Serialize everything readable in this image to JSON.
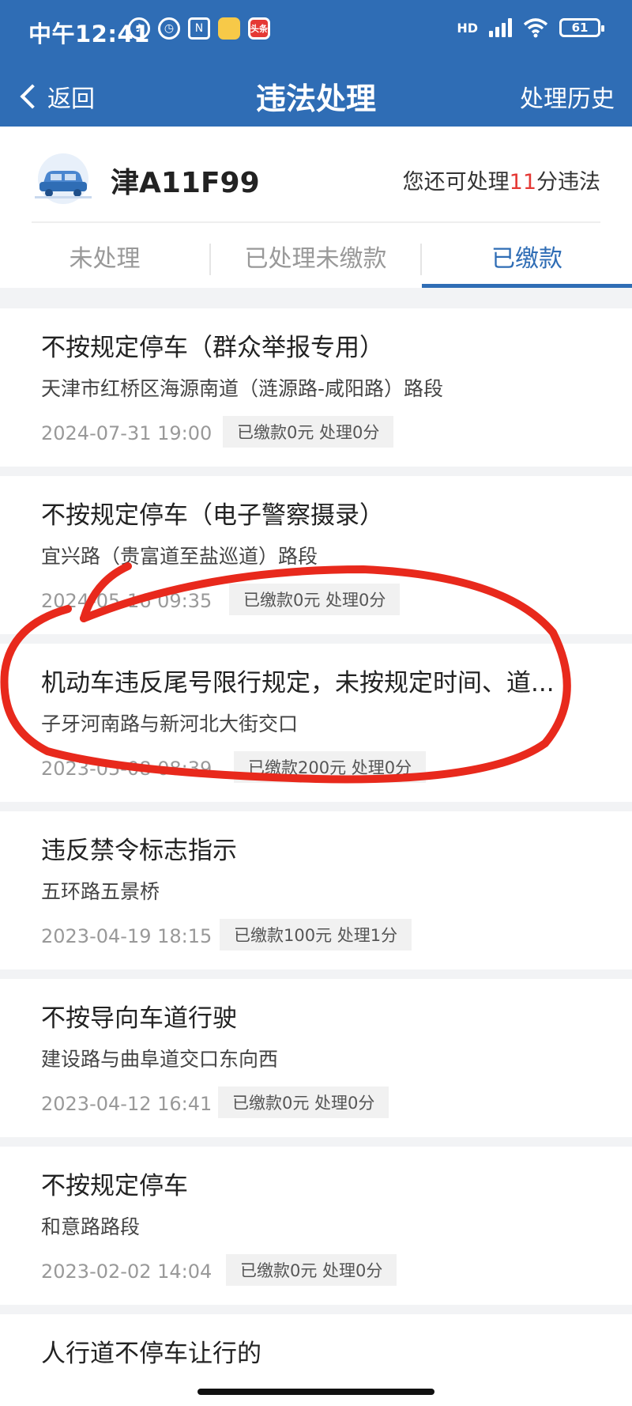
{
  "status_bar": {
    "time": "中午12:41",
    "icons": [
      "bell-off-icon",
      "alarm-icon",
      "nfc-icon",
      "app-icon",
      "toutiao-icon"
    ],
    "app_badge": "头条",
    "network": "HD",
    "battery": "61"
  },
  "nav": {
    "back_label": "返回",
    "title": "违法处理",
    "history_label": "处理历史"
  },
  "vehicle": {
    "plate": "津A11F99",
    "remain_prefix": "您还可处理",
    "remain_points": "11",
    "remain_suffix": "分违法"
  },
  "tabs": [
    {
      "label": "未处理",
      "active": false
    },
    {
      "label": "已处理未缴款",
      "active": false
    },
    {
      "label": "已缴款",
      "active": true
    }
  ],
  "records": [
    {
      "title": "不按规定停车（群众举报专用）",
      "location": "天津市红桥区海源南道（涟源路-咸阳路）路段",
      "date": "2024-07-31 19:00",
      "status": "已缴款0元 处理0分"
    },
    {
      "title": "不按规定停车（电子警察摄录）",
      "location": "宜兴路（贵富道至盐巡道）路段",
      "date": "2024-05-16 09:35",
      "status": "已缴款0元 处理0分"
    },
    {
      "title": "机动车违反尾号限行规定，未按规定时间、道...",
      "location": "子牙河南路与新河北大街交口",
      "date": "2023-05-08 08:39",
      "status": "已缴款200元 处理0分"
    },
    {
      "title": "违反禁令标志指示",
      "location": "五环路五景桥",
      "date": "2023-04-19 18:15",
      "status": "已缴款100元 处理1分"
    },
    {
      "title": "不按导向车道行驶",
      "location": "建设路与曲阜道交口东向西",
      "date": "2023-04-12 16:41",
      "status": "已缴款0元 处理0分"
    },
    {
      "title": "不按规定停车",
      "location": "和意路路段",
      "date": "2023-02-02 14:04",
      "status": "已缴款0元 处理0分"
    },
    {
      "title": "人行道不停车让行的",
      "location": "",
      "date": "",
      "status": ""
    }
  ],
  "colors": {
    "brand": "#2f6db5",
    "highlight": "#e53935",
    "annotation": "#e8291c"
  }
}
